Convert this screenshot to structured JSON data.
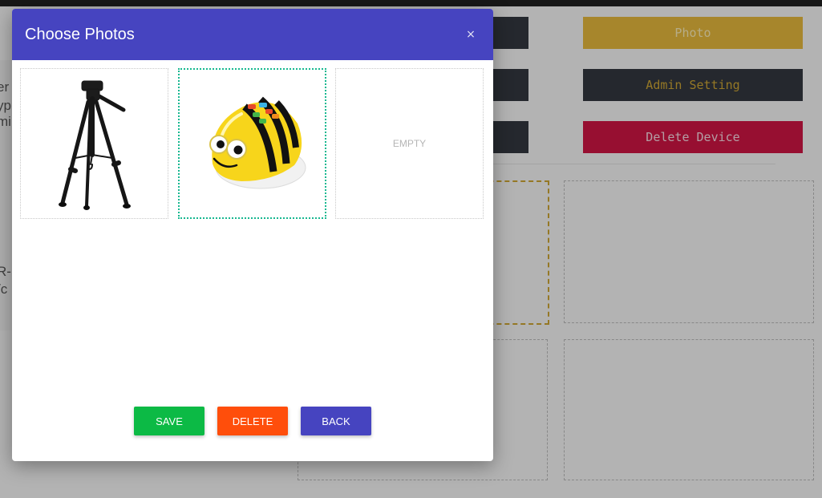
{
  "background": {
    "buttons": {
      "photo": "Photo",
      "admin_setting": "Admin Setting",
      "delete_device": "Delete Device"
    },
    "left_fragments": [
      "er",
      "yp",
      "mi",
      "R-F",
      "/c"
    ]
  },
  "modal": {
    "title": "Choose Photos",
    "close_symbol": "×",
    "slots": [
      {
        "content": "tripod-photo",
        "selected": false
      },
      {
        "content": "bee-bot-photo",
        "selected": true
      },
      {
        "content": "empty",
        "label": "EMPTY",
        "selected": false
      }
    ],
    "buttons": {
      "save": "SAVE",
      "delete": "DELETE",
      "back": "BACK"
    }
  },
  "colors": {
    "header": "#4644c0",
    "save": "#0cba45",
    "delete": "#ff4e0b",
    "back": "#4644c0",
    "selected_border": "#17b890",
    "photo_button": "#e2b53c",
    "delete_device_button": "#cc1543",
    "dark_button": "#33363f"
  }
}
